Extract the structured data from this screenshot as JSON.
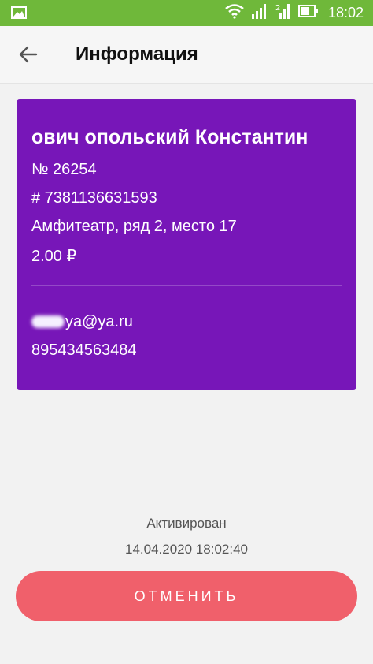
{
  "status_bar": {
    "time": "18:02",
    "icons": [
      "image-icon",
      "wifi-icon",
      "signal-icon",
      "signal-2-icon",
      "battery-icon"
    ],
    "color": "#6fb83a"
  },
  "app_bar": {
    "title": "Информация",
    "back_icon": "arrow-left-icon"
  },
  "ticket": {
    "holder_name": "ович  опольский Константин",
    "number": "№ 26254",
    "barcode": "# 7381136631593",
    "seat": "Амфитеатр, ряд 2, место 17",
    "price": "2.00 ₽",
    "email": "ya@ya.ru",
    "phone": "895434563484",
    "card_color": "#7716b8"
  },
  "activation": {
    "status": "Активирован",
    "datetime": "14.04.2020 18:02:40"
  },
  "actions": {
    "cancel_label": "ОТМЕНИТЬ",
    "cancel_color": "#f0606b"
  }
}
